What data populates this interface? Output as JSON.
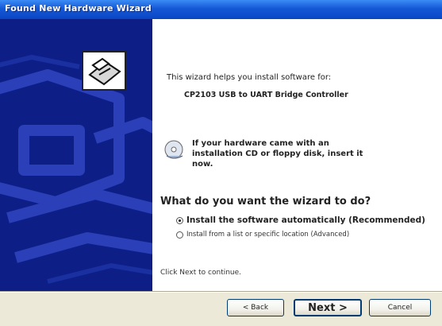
{
  "window": {
    "title": "Found New Hardware Wizard"
  },
  "content": {
    "intro": "This wizard helps you install software for:",
    "device": "CP2103 USB to UART Bridge Controller",
    "cd_prompt": "If your hardware came with an installation CD or floppy disk, insert it now.",
    "question": "What do you want the wizard to do?",
    "options": [
      {
        "label": "Install the software automatically (Recommended)",
        "selected": true
      },
      {
        "label": "Install from a list or specific location (Advanced)",
        "selected": false
      }
    ],
    "continue_text": "Click Next to continue."
  },
  "buttons": {
    "back": "< Back",
    "next": "Next >",
    "cancel": "Cancel"
  },
  "colors": {
    "title_bar": "#1558d6",
    "side_panel": "#0d1f86",
    "dialog_face": "#ece9d8"
  }
}
